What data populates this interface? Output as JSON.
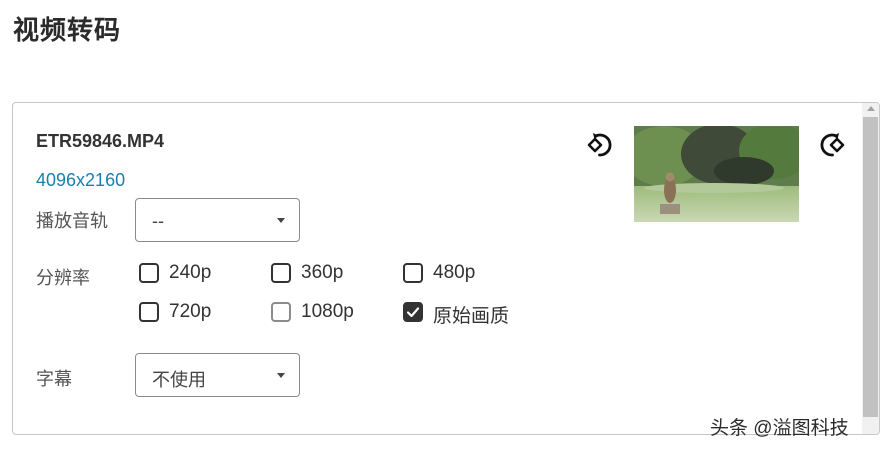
{
  "page": {
    "title": "视频转码"
  },
  "file": {
    "name": "ETR59846.MP4",
    "resolution": "4096x2160"
  },
  "audio_track": {
    "label": "播放音轨",
    "value": "--"
  },
  "resolution_options": {
    "label": "分辨率",
    "items": [
      {
        "label": "240p",
        "checked": false,
        "disabled": false
      },
      {
        "label": "360p",
        "checked": false,
        "disabled": false
      },
      {
        "label": "480p",
        "checked": false,
        "disabled": false
      },
      {
        "label": "720p",
        "checked": false,
        "disabled": false
      },
      {
        "label": "1080p",
        "checked": false,
        "disabled": true
      },
      {
        "label": "原始画质",
        "checked": true,
        "disabled": false
      }
    ]
  },
  "subtitle": {
    "label": "字幕",
    "value": "不使用"
  },
  "icons": {
    "rotate_left": "rotate-left-icon",
    "rotate_right": "rotate-right-icon"
  },
  "watermark": {
    "text": "头条 @溢图科技"
  },
  "colors": {
    "resolution_text": "#1a7fb0",
    "checked_box": "#333333"
  }
}
